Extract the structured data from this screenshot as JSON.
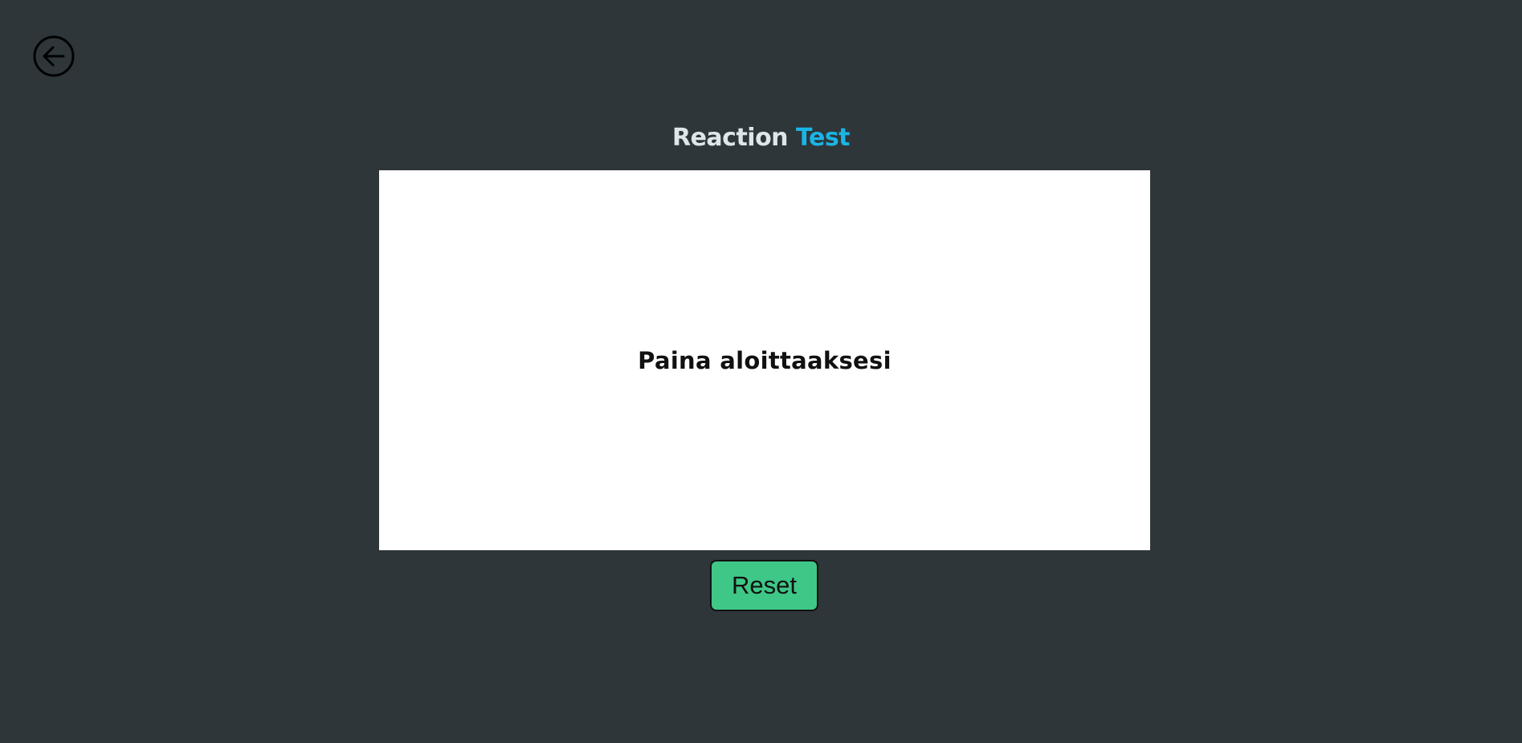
{
  "header": {
    "back_icon": "arrow-left-circle-icon"
  },
  "title": {
    "part1": "Reaction",
    "part2": "Test",
    "accent_color": "#1ab5e6"
  },
  "test_area": {
    "prompt": "Paina aloittaaksesi",
    "background": "#ffffff"
  },
  "controls": {
    "reset_label": "Reset",
    "reset_color": "#3ec787"
  },
  "theme": {
    "background": "#2e363a"
  }
}
